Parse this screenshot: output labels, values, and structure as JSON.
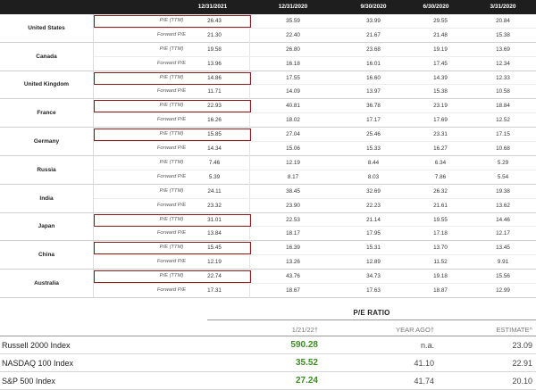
{
  "country_table": {
    "headers": [
      "12/31/2021",
      "12/31/2020",
      "9/30/2020",
      "6/30/2020",
      "3/31/2020"
    ],
    "countries": [
      {
        "name": "United States",
        "highlight": true,
        "rows": [
          {
            "label": "P/E (TTM)",
            "values": [
              "26.43",
              "35.59",
              "33.99",
              "29.55",
              "20.84"
            ]
          },
          {
            "label": "Forward P/E",
            "values": [
              "21.30",
              "22.40",
              "21.67",
              "21.48",
              "15.38"
            ]
          }
        ]
      },
      {
        "name": "Canada",
        "highlight": false,
        "rows": [
          {
            "label": "P/E (TTM)",
            "values": [
              "19.58",
              "26.80",
              "23.68",
              "19.19",
              "13.69"
            ]
          },
          {
            "label": "Forward P/E",
            "values": [
              "13.96",
              "16.18",
              "16.01",
              "17.45",
              "12.34"
            ]
          }
        ]
      },
      {
        "name": "United Kingdom",
        "highlight": true,
        "rows": [
          {
            "label": "P/E (TTM)",
            "values": [
              "14.86",
              "17.55",
              "16.60",
              "14.39",
              "12.33"
            ]
          },
          {
            "label": "Forward P/E",
            "values": [
              "11.71",
              "14.09",
              "13.97",
              "15.38",
              "10.58"
            ]
          }
        ]
      },
      {
        "name": "France",
        "highlight": true,
        "rows": [
          {
            "label": "P/E (TTM)",
            "values": [
              "22.93",
              "40.81",
              "36.78",
              "23.19",
              "18.84"
            ]
          },
          {
            "label": "Forward P/E",
            "values": [
              "16.26",
              "18.02",
              "17.17",
              "17.69",
              "12.52"
            ]
          }
        ]
      },
      {
        "name": "Germany",
        "highlight": true,
        "rows": [
          {
            "label": "P/E (TTM)",
            "values": [
              "15.85",
              "27.04",
              "25.46",
              "23.31",
              "17.15"
            ]
          },
          {
            "label": "Forward P/E",
            "values": [
              "14.34",
              "15.06",
              "15.33",
              "16.27",
              "10.68"
            ]
          }
        ]
      },
      {
        "name": "Russia",
        "highlight": false,
        "rows": [
          {
            "label": "P/E (TTM)",
            "values": [
              "7.46",
              "12.19",
              "8.44",
              "6.34",
              "5.29"
            ]
          },
          {
            "label": "Forward P/E",
            "values": [
              "5.39",
              "8.17",
              "8.03",
              "7.86",
              "5.54"
            ]
          }
        ]
      },
      {
        "name": "India",
        "highlight": false,
        "rows": [
          {
            "label": "P/E (TTM)",
            "values": [
              "24.11",
              "38.45",
              "32.69",
              "26.32",
              "19.38"
            ]
          },
          {
            "label": "Forward P/E",
            "values": [
              "23.32",
              "23.90",
              "22.23",
              "21.61",
              "13.62"
            ]
          }
        ]
      },
      {
        "name": "Japan",
        "highlight": true,
        "rows": [
          {
            "label": "P/E (TTM)",
            "values": [
              "31.01",
              "22.53",
              "21.14",
              "19.55",
              "14.46"
            ]
          },
          {
            "label": "Forward P/E",
            "values": [
              "13.84",
              "18.17",
              "17.95",
              "17.18",
              "12.17"
            ]
          }
        ]
      },
      {
        "name": "China",
        "highlight": true,
        "rows": [
          {
            "label": "P/E (TTM)",
            "values": [
              "15.45",
              "16.39",
              "15.31",
              "13.70",
              "13.45"
            ]
          },
          {
            "label": "Forward P/E",
            "values": [
              "12.19",
              "13.26",
              "12.89",
              "11.52",
              "9.91"
            ]
          }
        ]
      },
      {
        "name": "Australia",
        "highlight": true,
        "rows": [
          {
            "label": "P/E (TTM)",
            "values": [
              "22.74",
              "43.76",
              "34.73",
              "19.18",
              "15.56"
            ]
          },
          {
            "label": "Forward P/E",
            "values": [
              "17.31",
              "18.67",
              "17.63",
              "18.87",
              "12.99"
            ]
          }
        ]
      }
    ]
  },
  "index_table": {
    "title": "P/E RATIO",
    "columns": [
      "1/21/22†",
      "YEAR AGO†",
      "ESTIMATE^"
    ],
    "rows": [
      {
        "name": "Russell 2000 Index",
        "values": [
          "590.28",
          "n.a.",
          "23.09"
        ]
      },
      {
        "name": "NASDAQ 100 Index",
        "values": [
          "35.52",
          "41.10",
          "22.91"
        ]
      },
      {
        "name": "S&P 500 Index",
        "values": [
          "27.24",
          "41.74",
          "20.10"
        ]
      }
    ]
  },
  "colors": {
    "header_bg": "#1e1e1e",
    "highlight_border": "#8a1c1c",
    "current_value_green": "#3a8f1f"
  }
}
